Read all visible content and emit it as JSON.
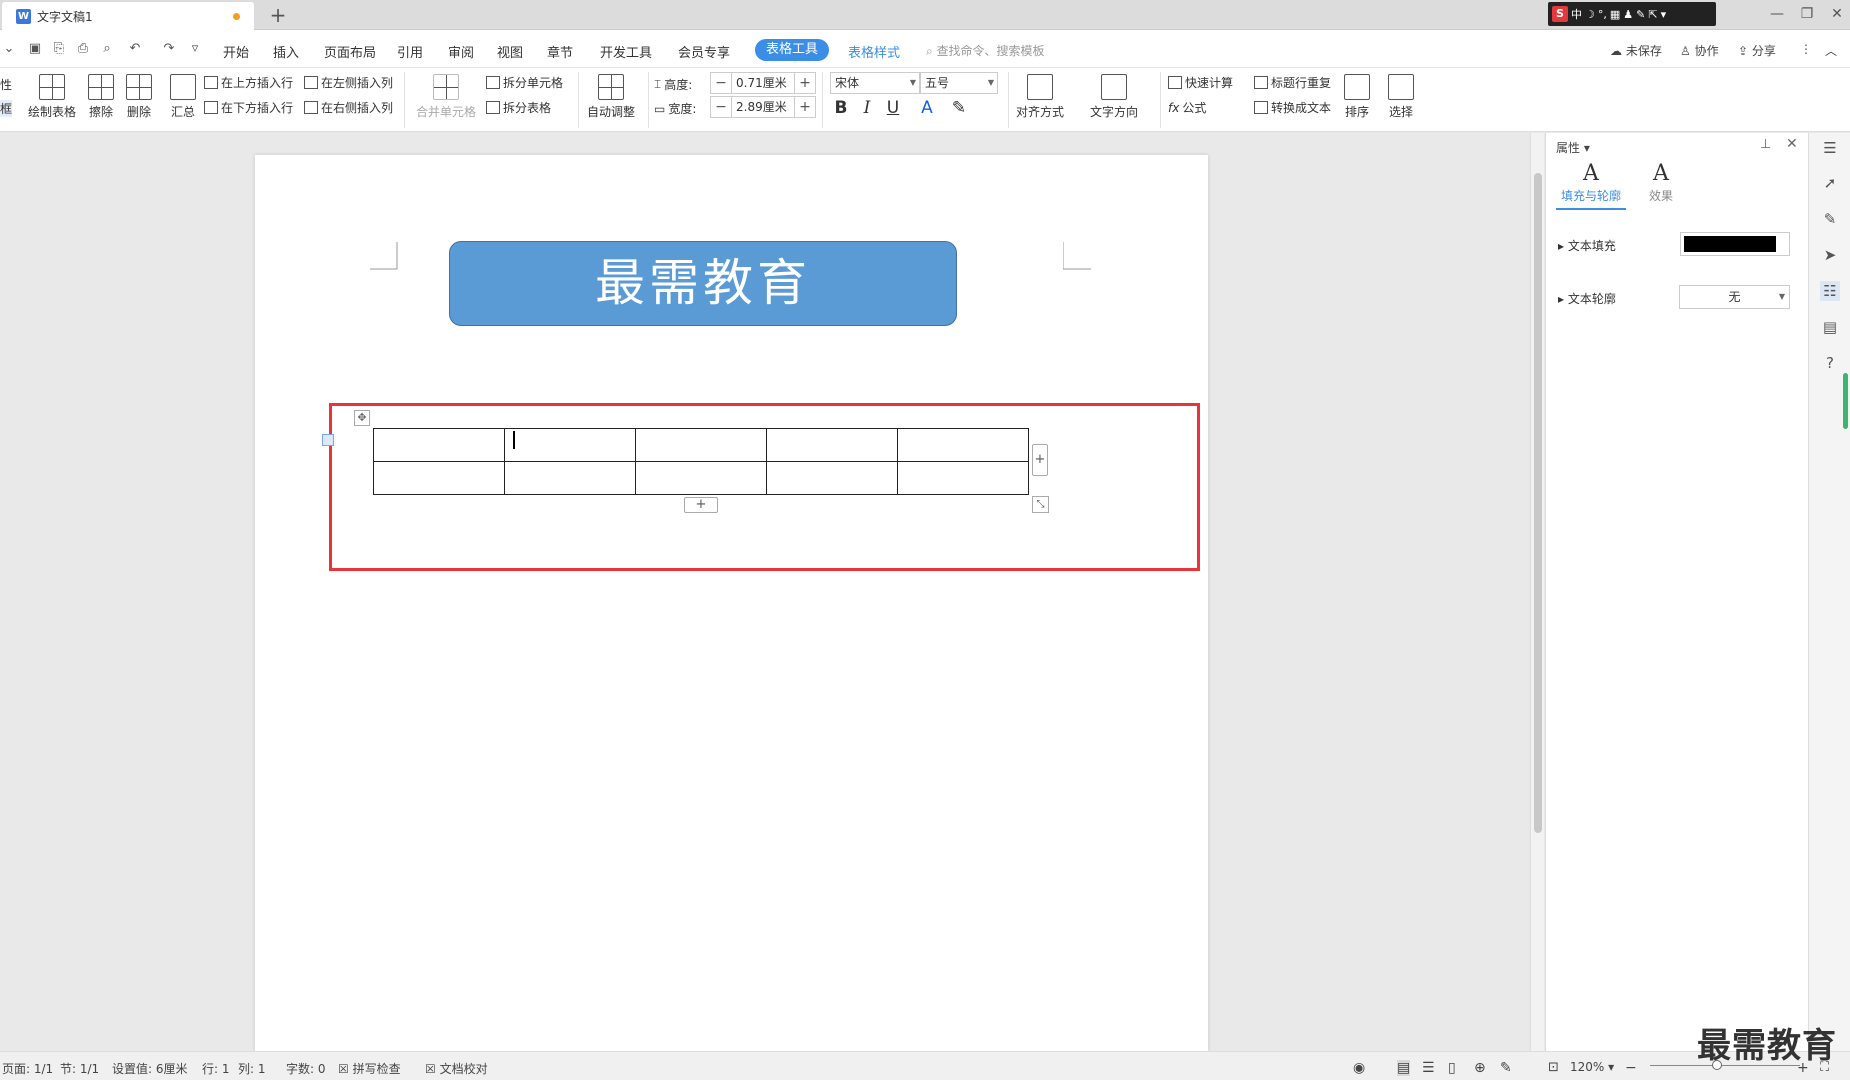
{
  "window": {
    "tab_title": "文字文稿1",
    "new_tab": "+",
    "ime": [
      "中",
      "☽",
      "°,",
      "▦",
      "♟",
      "✎",
      "⇱",
      "▾"
    ],
    "controls": [
      "—",
      "❐",
      "✕"
    ]
  },
  "menu": {
    "items": [
      "开始",
      "插入",
      "页面布局",
      "引用",
      "审阅",
      "视图",
      "章节",
      "开发工具",
      "会员专享"
    ],
    "active": "表格工具",
    "style_tab": "表格样式",
    "search": "查找命令、搜索模板",
    "right": [
      "未保存",
      "协作",
      "分享"
    ]
  },
  "ribbon": {
    "draw_table": "绘制表格",
    "erase": "擦除",
    "delete": "删除",
    "summary": "汇总",
    "insert_above": "在上方插入行",
    "insert_below": "在下方插入行",
    "insert_left": "在左侧插入列",
    "insert_right": "在右侧插入列",
    "merge_cells": "合并单元格",
    "split_cells": "拆分单元格",
    "split_table": "拆分表格",
    "auto_fit": "自动调整",
    "height_label": "高度:",
    "height_value": "0.71厘米",
    "width_label": "宽度:",
    "width_value": "2.89厘米",
    "font_name": "宋体",
    "font_size": "五号",
    "align": "对齐方式",
    "text_direction": "文字方向",
    "quick_calc": "快速计算",
    "formula": "公式",
    "header_repeat": "标题行重复",
    "convert_text": "转换成文本",
    "sort": "排序",
    "select": "选择",
    "left_cut_top": "性",
    "left_cut_bottom": "框"
  },
  "document": {
    "title": "最需教育",
    "table": {
      "rows": 2,
      "cols": 5
    }
  },
  "properties": {
    "header": "属性",
    "tab_fill": "填充与轮廓",
    "tab_effect": "效果",
    "text_fill": "文本填充",
    "text_outline": "文本轮廓",
    "outline_value": "无",
    "fill_color": "#000000"
  },
  "status": {
    "page": "页面: 1/1",
    "section": "节: 1/1",
    "setting": "设置值: 6厘米",
    "row": "行: 1",
    "col": "列: 1",
    "words": "字数: 0",
    "spell": "拼写检查",
    "proof": "文档校对",
    "zoom": "120%"
  },
  "watermark": "最需教育",
  "colors": {
    "accent": "#3a8ee6",
    "title_box": "#5b9bd5",
    "highlight": "#e8353b"
  }
}
